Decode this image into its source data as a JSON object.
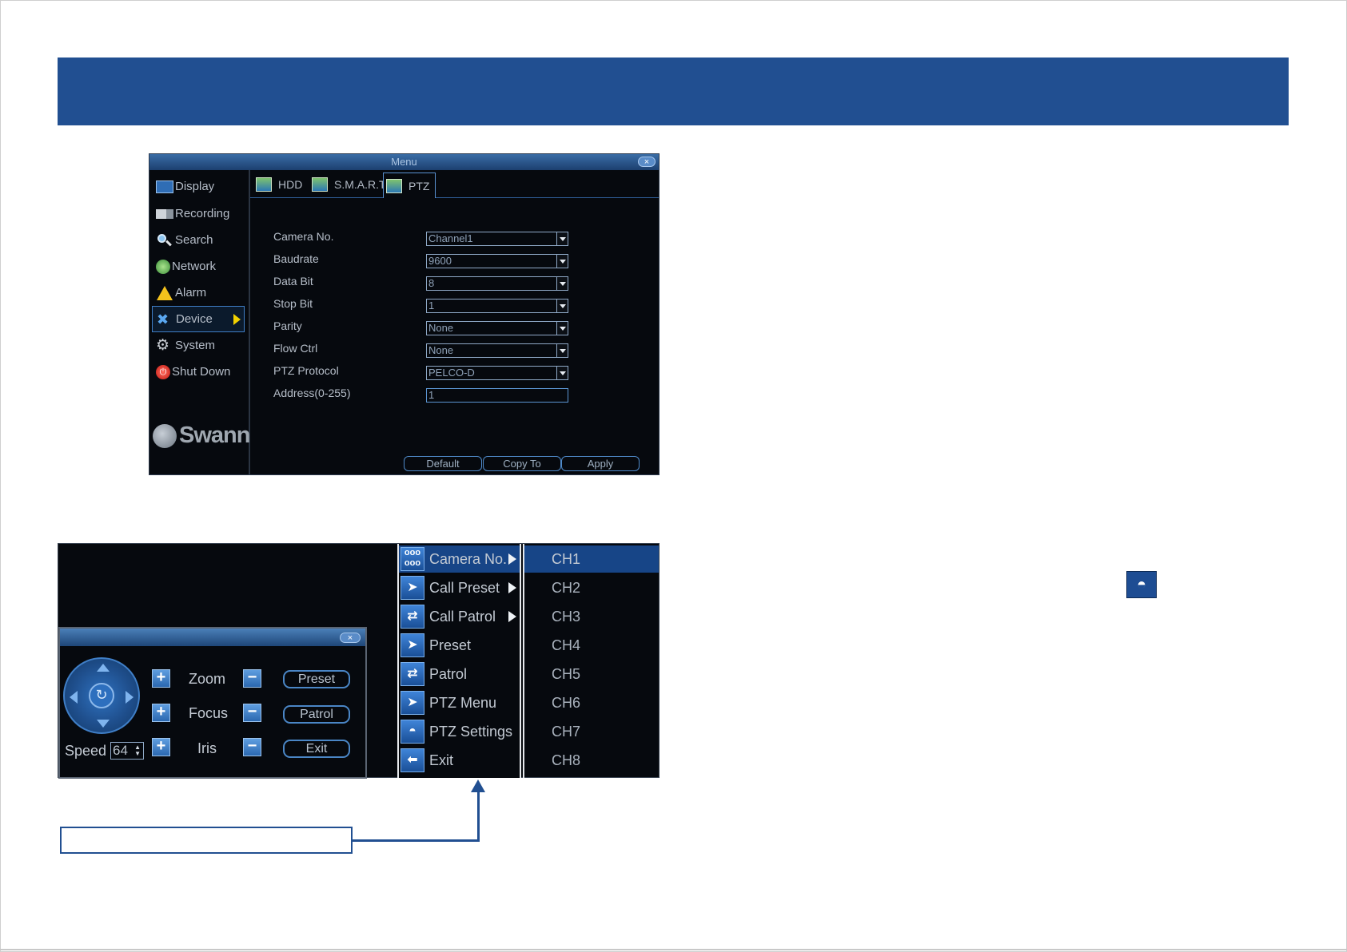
{
  "menu_window": {
    "title": "Menu",
    "close": "×",
    "sidebar": [
      {
        "label": "Display",
        "icon": "display-icon"
      },
      {
        "label": "Recording",
        "icon": "recording-icon"
      },
      {
        "label": "Search",
        "icon": "search-icon"
      },
      {
        "label": "Network",
        "icon": "network-icon"
      },
      {
        "label": "Alarm",
        "icon": "alarm-icon"
      },
      {
        "label": "Device",
        "icon": "device-icon",
        "active": true
      },
      {
        "label": "System",
        "icon": "gear-icon"
      },
      {
        "label": "Shut Down",
        "icon": "power-icon"
      }
    ],
    "logo": "Swann",
    "tabs": [
      {
        "label": "HDD"
      },
      {
        "label": "S.M.A.R.T"
      },
      {
        "label": "PTZ",
        "active": true
      }
    ],
    "fields": [
      {
        "label": "Camera No.",
        "value": "Channel1"
      },
      {
        "label": "Baudrate",
        "value": "9600"
      },
      {
        "label": "Data Bit",
        "value": "8"
      },
      {
        "label": "Stop Bit",
        "value": "1"
      },
      {
        "label": "Parity",
        "value": "None"
      },
      {
        "label": "Flow Ctrl",
        "value": "None"
      },
      {
        "label": "PTZ Protocol",
        "value": "PELCO-D"
      },
      {
        "label": "Address(0-255)",
        "value": "1"
      }
    ],
    "buttons": {
      "default": "Default",
      "copy_to": "Copy To",
      "apply": "Apply"
    }
  },
  "ptz_panel": {
    "close": "×",
    "zoom": "Zoom",
    "focus": "Focus",
    "iris": "Iris",
    "speed_label": "Speed",
    "speed_value": "64",
    "preset": "Preset",
    "patrol": "Patrol",
    "exit": "Exit",
    "plus": "+",
    "minus": "−"
  },
  "context_menu": [
    {
      "label": "Camera No.",
      "icon": "grid-icon",
      "submenu": true,
      "active": true
    },
    {
      "label": "Call Preset",
      "icon": "cursor-icon",
      "submenu": true
    },
    {
      "label": "Call Patrol",
      "icon": "arrows-icon",
      "submenu": true
    },
    {
      "label": "Preset",
      "icon": "cursor-icon"
    },
    {
      "label": "Patrol",
      "icon": "arrows-icon"
    },
    {
      "label": "PTZ Menu",
      "icon": "cursor-icon"
    },
    {
      "label": "PTZ Settings",
      "icon": "dome-camera-icon"
    },
    {
      "label": "Exit",
      "icon": "arrow-left-icon"
    }
  ],
  "channels": [
    "CH1",
    "CH2",
    "CH3",
    "CH4",
    "CH5",
    "CH6",
    "CH7",
    "CH8"
  ],
  "colors": {
    "banner": "#214f91",
    "highlight": "#174587",
    "accent": "#4a86c6",
    "arrow": "#f2d100"
  }
}
